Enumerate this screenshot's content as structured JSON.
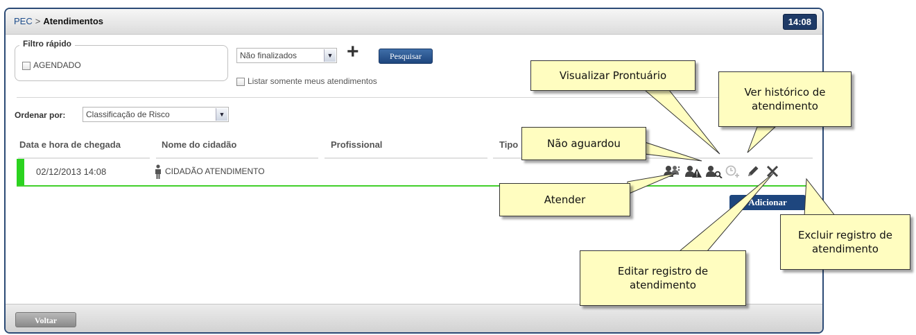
{
  "header": {
    "breadcrumb_root": "PEC",
    "separator": ">",
    "breadcrumb_current": "Atendimentos",
    "clock": "14:08"
  },
  "filter": {
    "legend": "Filtro rápido",
    "agendado_label": "AGENDADO",
    "status_select": "Não finalizados",
    "search_button": "Pesquisar",
    "only_mine_label": "Listar somente meus atendimentos"
  },
  "sort": {
    "label": "Ordenar por:",
    "value": "Classificação de Risco"
  },
  "table": {
    "headers": [
      "Data e hora de chegada",
      "Nome do cidadão",
      "Profissional",
      "Tipo"
    ],
    "rows": [
      {
        "arrival": "02/12/2013 14:08",
        "name": "CIDADÃO ATENDIMENTO",
        "status_color": "#2bd31f"
      }
    ]
  },
  "row_actions": [
    "attend-icon",
    "not-waited-icon",
    "view-record-icon",
    "history-icon",
    "edit-icon",
    "delete-icon"
  ],
  "buttons": {
    "add": "Adicionar",
    "back": "Voltar"
  },
  "callouts": {
    "visualizar": "Visualizar Prontuário",
    "historico": "Ver histórico de atendimento",
    "nao_aguardou": "Não aguardou",
    "atender": "Atender",
    "editar": "Editar registro de atendimento",
    "excluir": "Excluir registro de atendimento"
  },
  "colors": {
    "accent": "#1e3a66",
    "status_green": "#2bd31f",
    "callout_bg": "#fffdc0"
  }
}
